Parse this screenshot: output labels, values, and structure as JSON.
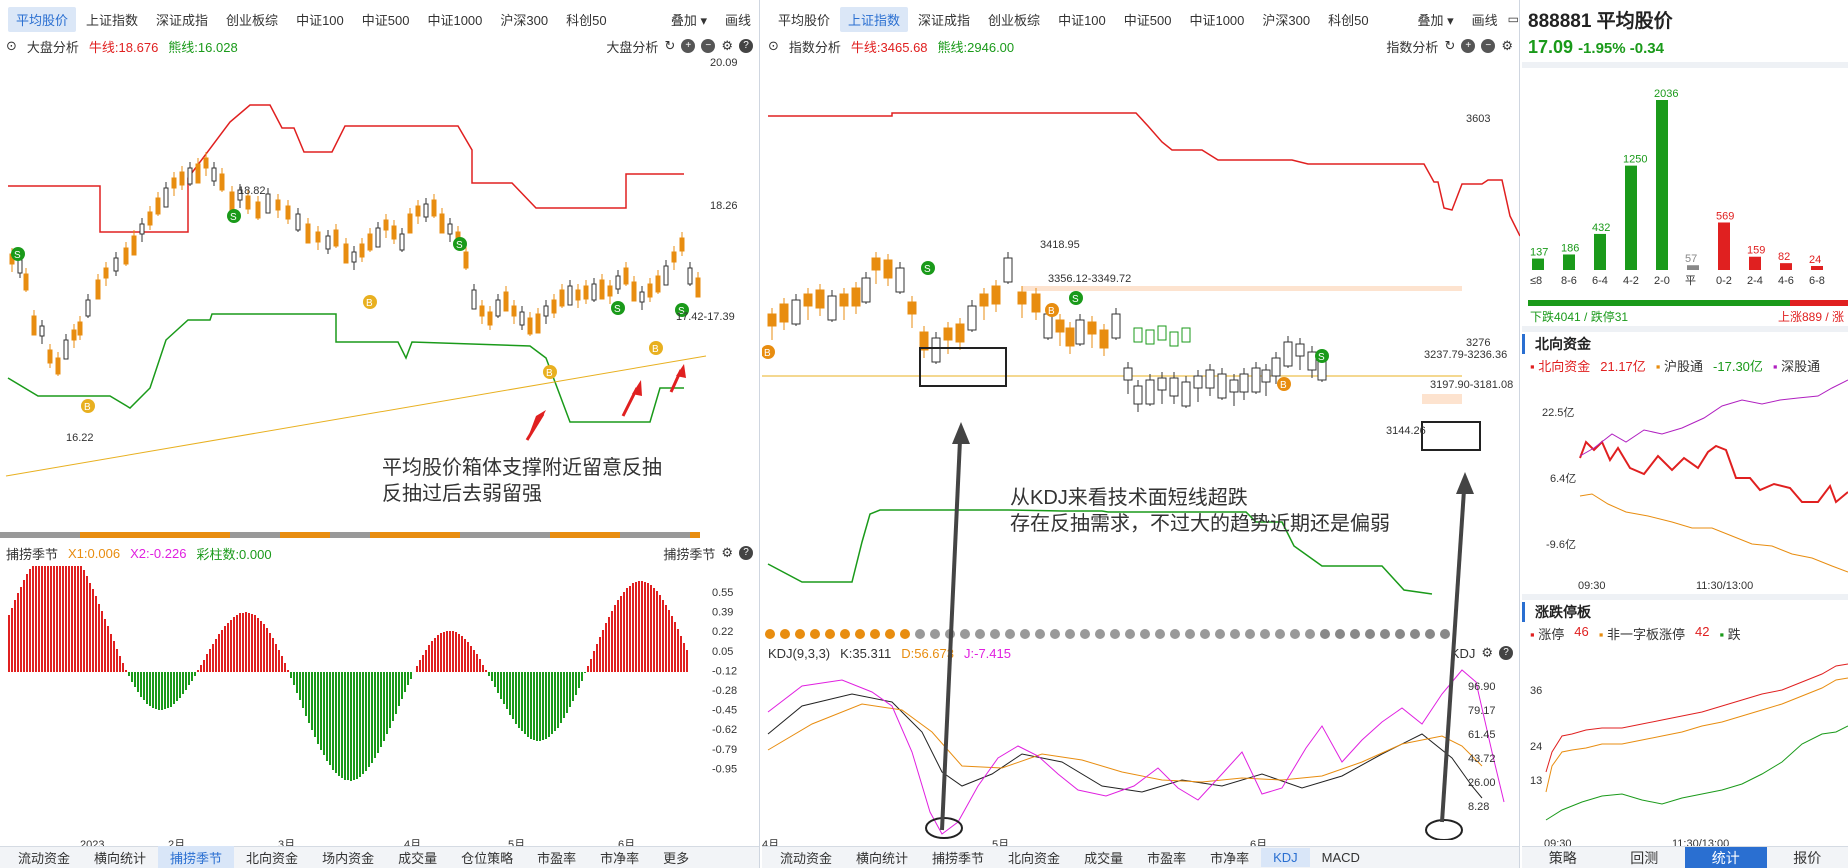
{
  "left": {
    "tabs": [
      "平均股价",
      "上证指数",
      "深证成指",
      "创业板综",
      "中证100",
      "中证500",
      "中证1000",
      "沪深300",
      "科创50"
    ],
    "active_tab": 0,
    "overlay_btn": "叠加",
    "draw_btn": "画线",
    "toolbar": {
      "title": "大盘分析",
      "bull_label": "牛线:18.676",
      "bear_label": "熊线:16.028",
      "right_label": "大盘分析"
    },
    "price_axis": [
      "20.09",
      "18.26"
    ],
    "high_marker": "18.82",
    "low_marker": "16.22",
    "range_marker": "17.42-17.39",
    "annotation_line1": "平均股价箱体支撑附近留意反抽",
    "annotation_line2": "反抽过后去弱留强",
    "sub_toolbar": {
      "title": "捕捞季节",
      "x1": "X1:0.006",
      "x2": "X2:-0.226",
      "bars": "彩柱数:0.000",
      "right_label": "捕捞季节"
    },
    "sub_axis": [
      "0.55",
      "0.39",
      "0.22",
      "0.05",
      "-0.12",
      "-0.28",
      "-0.45",
      "-0.62",
      "-0.79",
      "-0.95"
    ],
    "x_axis": [
      "2023",
      "2月",
      "3月",
      "4月",
      "5月",
      "6月"
    ],
    "bottom_tabs": [
      "流动资金",
      "横向统计",
      "捕捞季节",
      "北向资金",
      "场内资金",
      "成交量",
      "仓位策略",
      "市盈率",
      "市净率",
      "更多"
    ],
    "bottom_active": 2
  },
  "mid": {
    "tabs": [
      "平均股价",
      "上证指数",
      "深证成指",
      "创业板综",
      "中证100",
      "中证500",
      "中证1000",
      "沪深300",
      "科创50"
    ],
    "active_tab": 1,
    "overlay_btn": "叠加",
    "draw_btn": "画线",
    "toolbar": {
      "title": "指数分析",
      "bull_label": "牛线:3465.68",
      "bear_label": "熊线:2946.00",
      "right_label": "指数分析"
    },
    "price_axis": [
      "3603",
      "3276"
    ],
    "high_marker": "3418.95",
    "zone1": "3356.12-3349.72",
    "zone2": "3237.79-3236.36",
    "zone3": "3197.90-3181.08",
    "low_marker": "3144.26",
    "annotation_line1": "从KDJ来看技术面短线超跌",
    "annotation_line2": "存在反抽需求，不过大的趋势近期还是偏弱",
    "sub_toolbar": {
      "title": "KDJ(9,3,3)",
      "k": "K:35.311",
      "d": "D:56.673",
      "j": "J:-7.415",
      "right_label": "KDJ"
    },
    "sub_axis": [
      "96.90",
      "79.17",
      "61.45",
      "43.72",
      "26.00",
      "8.28"
    ],
    "x_axis": [
      "4月",
      "5月",
      "6月"
    ],
    "bottom_tabs": [
      "流动资金",
      "横向统计",
      "捕捞季节",
      "北向资金",
      "成交量",
      "市盈率",
      "市净率",
      "KDJ",
      "MACD"
    ],
    "bottom_active": 7
  },
  "right": {
    "code_title": "888881 平均股价",
    "price": "17.09",
    "change": "-1.95%  -0.34",
    "dist_chart": {
      "categories": [
        "≤8",
        "8-6",
        "6-4",
        "4-2",
        "2-0",
        "平",
        "0-2",
        "2-4",
        "4-6",
        "6-8"
      ],
      "values": [
        137,
        186,
        432,
        1250,
        2036,
        57,
        569,
        159,
        82,
        24
      ],
      "labels": [
        "137",
        "186",
        "432",
        "1250",
        "2036",
        "57",
        "569",
        "159",
        "82",
        "24"
      ]
    },
    "down_text": "下跌4041 / 跌停31",
    "up_text": "上涨889 / 涨",
    "north_title": "北向资金",
    "north_legend": [
      "北向资金",
      "21.17亿",
      "沪股通",
      "-17.30亿",
      "深股通"
    ],
    "north_axis": [
      "22.5亿",
      "6.4亿",
      "-9.6亿"
    ],
    "north_time": [
      "09:30",
      "11:30/13:00"
    ],
    "limit_title": "涨跌停板",
    "limit_legend": [
      "涨停",
      "46",
      "非一字板涨停",
      "42",
      "跌"
    ],
    "limit_axis": [
      "36",
      "24",
      "13"
    ],
    "limit_time": [
      "09:30",
      "11:30/13:00"
    ],
    "bottom_tabs": [
      "策略",
      "回测",
      "统计",
      "报价"
    ],
    "bottom_active": 2
  },
  "colors": {
    "up": "#e02020",
    "down": "#1a9a1a",
    "candle_up": "#e88d10",
    "accent": "#2a6fd1"
  }
}
